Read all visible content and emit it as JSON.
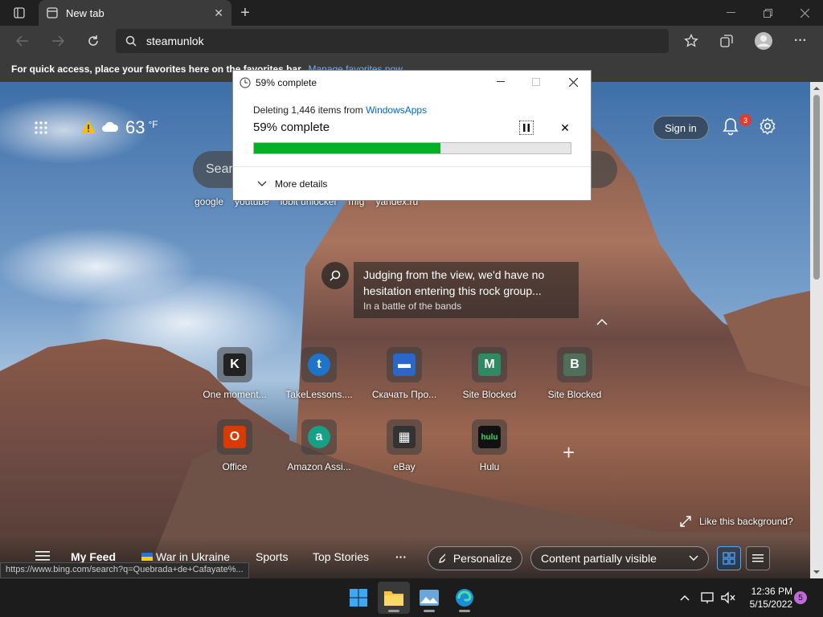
{
  "browser": {
    "tab_title": "New tab",
    "address": "steamunlok",
    "favbar_text": "For quick access, place your favorites here on the favorites bar.",
    "favbar_link": "Manage favorites now"
  },
  "weather": {
    "temp": "63",
    "unit": "°F"
  },
  "header": {
    "signin_label": "Sign in",
    "notification_count": "3"
  },
  "search": {
    "placeholder": "Sear",
    "quick_links": [
      "google",
      "youtube",
      "iobit unlocker",
      "mfg",
      "yandex.ru"
    ]
  },
  "caption": {
    "title": "Judging from the view, we'd have no hesitation entering this rock group...",
    "subtitle": "In a battle of the bands"
  },
  "tiles": [
    {
      "label": "One moment...",
      "glyph": "K",
      "color": "#222222"
    },
    {
      "label": "TakeLessons....",
      "glyph": "t",
      "color": "#1f73c9"
    },
    {
      "label": "Скачать Про...",
      "glyph": "▬",
      "color": "#2a67c9"
    },
    {
      "label": "Site Blocked",
      "glyph": "M",
      "color": "#2f8a63"
    },
    {
      "label": "Site Blocked",
      "glyph": "B",
      "color": "#4f6f5b"
    },
    {
      "label": "Office",
      "glyph": "O",
      "color": "#d83b01"
    },
    {
      "label": "Amazon Assi...",
      "glyph": "a",
      "color": "#16a085"
    },
    {
      "label": "eBay",
      "glyph": "▦",
      "color": "#333333"
    },
    {
      "label": "Hulu",
      "glyph": "hulu",
      "color": "#111111"
    }
  ],
  "like_background": "Like this background?",
  "feed": {
    "my_feed": "My Feed",
    "war": "War in Ukraine",
    "sports": "Sports",
    "top_stories": "Top Stories",
    "more": "···",
    "personalize": "Personalize",
    "content_visibility": "Content partially visible"
  },
  "status_url": "https://www.bing.com/search?q=Quebrada+de+Cafayate%...",
  "dialog": {
    "title": "59% complete",
    "deleting_prefix": "Deleting 1,446 items from",
    "source": "WindowsApps",
    "percent_text": "59% complete",
    "progress": 0.59,
    "more_details": "More details"
  },
  "taskbar": {
    "time": "12:36 PM",
    "date": "5/15/2022",
    "notifications": "5"
  },
  "colors": {
    "progress_green": "#06b025",
    "link_blue": "#0066cc",
    "accent": "#6ab0f3"
  }
}
